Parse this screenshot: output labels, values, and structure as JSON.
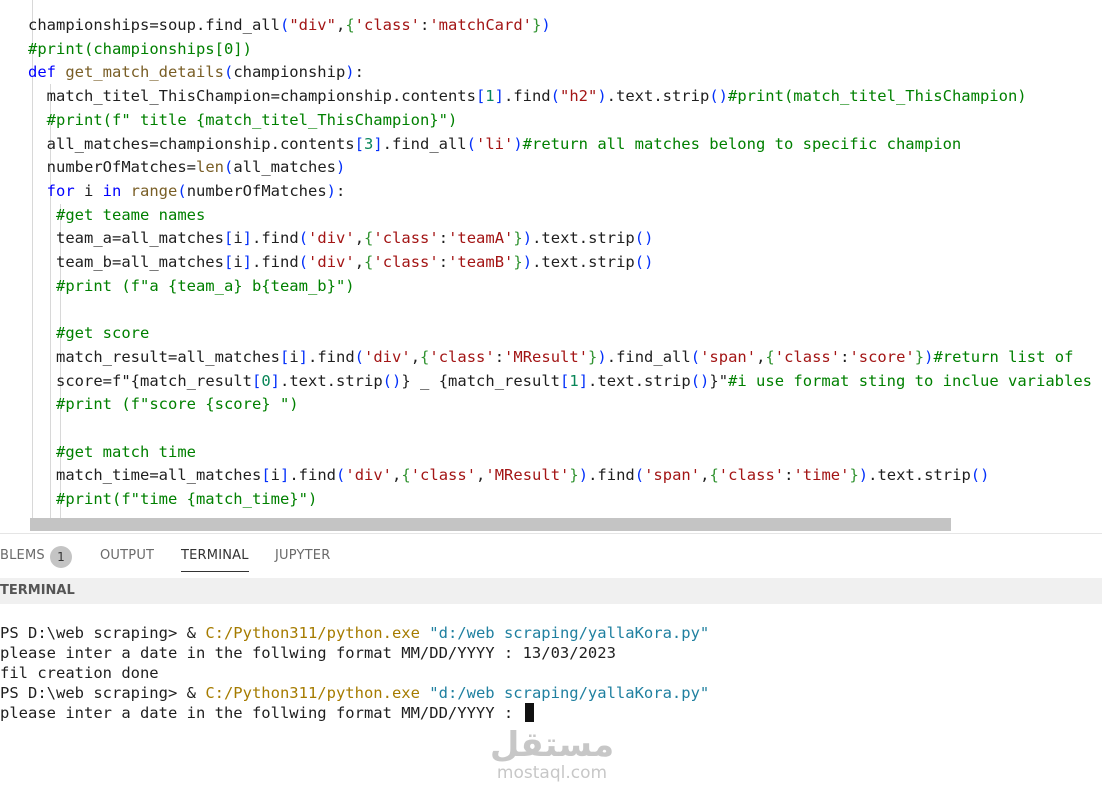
{
  "editor": {
    "lines": [
      {
        "indent": "   ",
        "tokens": [
          [
            "championships=soup.find_all",
            ""
          ],
          [
            "(",
            "p1"
          ],
          [
            "\"div\"",
            "str"
          ],
          [
            ",",
            ""
          ],
          [
            "{",
            "p2"
          ],
          [
            "'class'",
            "str"
          ],
          [
            ":",
            ""
          ],
          [
            "'matchCard'",
            "str"
          ],
          [
            "}",
            "p2"
          ],
          [
            ")",
            "p1"
          ]
        ]
      },
      {
        "indent": "   ",
        "tokens": [
          [
            "#print(championships[0])",
            "com"
          ]
        ]
      },
      {
        "indent": "   ",
        "tokens": [
          [
            "def ",
            "kw"
          ],
          [
            "get_match_details",
            "fn"
          ],
          [
            "(",
            "p1"
          ],
          [
            "championship",
            ""
          ],
          [
            ")",
            "p1"
          ],
          [
            ":",
            ""
          ]
        ]
      },
      {
        "indent": "     ",
        "tokens": [
          [
            "match_titel_ThisChampion=championship.contents",
            ""
          ],
          [
            "[",
            "p1"
          ],
          [
            "1",
            "num"
          ],
          [
            "]",
            "p1"
          ],
          [
            ".find",
            ""
          ],
          [
            "(",
            "p1"
          ],
          [
            "\"h2\"",
            "str"
          ],
          [
            ")",
            "p1"
          ],
          [
            ".text.strip",
            ""
          ],
          [
            "()",
            "p1"
          ],
          [
            "#print(match_titel_ThisChampion)",
            "com"
          ]
        ]
      },
      {
        "indent": "     ",
        "tokens": [
          [
            "#print(f\" title {match_titel_ThisChampion}\")",
            "com"
          ]
        ]
      },
      {
        "indent": "     ",
        "tokens": [
          [
            "all_matches=championship.contents",
            ""
          ],
          [
            "[",
            "p1"
          ],
          [
            "3",
            "num"
          ],
          [
            "]",
            "p1"
          ],
          [
            ".find_all",
            ""
          ],
          [
            "(",
            "p1"
          ],
          [
            "'li'",
            "str"
          ],
          [
            ")",
            "p1"
          ],
          [
            "#return all matches belong to specific champion",
            "com"
          ]
        ]
      },
      {
        "indent": "     ",
        "tokens": [
          [
            "numberOfMatches=",
            ""
          ],
          [
            "len",
            "fn"
          ],
          [
            "(",
            "p1"
          ],
          [
            "all_matches",
            ""
          ],
          [
            ")",
            "p1"
          ]
        ]
      },
      {
        "indent": "     ",
        "tokens": [
          [
            "for ",
            "kw"
          ],
          [
            "i ",
            ""
          ],
          [
            "in ",
            "kw"
          ],
          [
            "range",
            "fn"
          ],
          [
            "(",
            "p1"
          ],
          [
            "numberOfMatches",
            ""
          ],
          [
            ")",
            "p1"
          ],
          [
            ":",
            ""
          ]
        ]
      },
      {
        "indent": "      ",
        "tokens": [
          [
            "#get teame names",
            "com"
          ]
        ]
      },
      {
        "indent": "      ",
        "tokens": [
          [
            "team_a=all_matches",
            ""
          ],
          [
            "[",
            "p1"
          ],
          [
            "i",
            ""
          ],
          [
            "]",
            "p1"
          ],
          [
            ".find",
            ""
          ],
          [
            "(",
            "p1"
          ],
          [
            "'div'",
            "str"
          ],
          [
            ",",
            ""
          ],
          [
            "{",
            "p2"
          ],
          [
            "'class'",
            "str"
          ],
          [
            ":",
            ""
          ],
          [
            "'teamA'",
            "str"
          ],
          [
            "}",
            "p2"
          ],
          [
            ")",
            "p1"
          ],
          [
            ".text.strip",
            ""
          ],
          [
            "()",
            "p1"
          ]
        ]
      },
      {
        "indent": "      ",
        "tokens": [
          [
            "team_b=all_matches",
            ""
          ],
          [
            "[",
            "p1"
          ],
          [
            "i",
            ""
          ],
          [
            "]",
            "p1"
          ],
          [
            ".find",
            ""
          ],
          [
            "(",
            "p1"
          ],
          [
            "'div'",
            "str"
          ],
          [
            ",",
            ""
          ],
          [
            "{",
            "p2"
          ],
          [
            "'class'",
            "str"
          ],
          [
            ":",
            ""
          ],
          [
            "'teamB'",
            "str"
          ],
          [
            "}",
            "p2"
          ],
          [
            ")",
            "p1"
          ],
          [
            ".text.strip",
            ""
          ],
          [
            "()",
            "p1"
          ]
        ]
      },
      {
        "indent": "      ",
        "tokens": [
          [
            "#print (f\"a {team_a} b{team_b}\")",
            "com"
          ]
        ]
      },
      {
        "indent": "",
        "tokens": []
      },
      {
        "indent": "      ",
        "tokens": [
          [
            "#get score",
            "com"
          ]
        ]
      },
      {
        "indent": "      ",
        "tokens": [
          [
            "match_result=all_matches",
            ""
          ],
          [
            "[",
            "p1"
          ],
          [
            "i",
            ""
          ],
          [
            "]",
            "p1"
          ],
          [
            ".find",
            ""
          ],
          [
            "(",
            "p1"
          ],
          [
            "'div'",
            "str"
          ],
          [
            ",",
            ""
          ],
          [
            "{",
            "p2"
          ],
          [
            "'class'",
            "str"
          ],
          [
            ":",
            ""
          ],
          [
            "'MResult'",
            "str"
          ],
          [
            "}",
            "p2"
          ],
          [
            ")",
            "p1"
          ],
          [
            ".find_all",
            ""
          ],
          [
            "(",
            "p1"
          ],
          [
            "'span'",
            "str"
          ],
          [
            ",",
            ""
          ],
          [
            "{",
            "p2"
          ],
          [
            "'class'",
            "str"
          ],
          [
            ":",
            ""
          ],
          [
            "'score'",
            "str"
          ],
          [
            "}",
            "p2"
          ],
          [
            ")",
            "p1"
          ],
          [
            "#return list of",
            "com"
          ]
        ]
      },
      {
        "indent": "      ",
        "tokens": [
          [
            "score=f\"",
            ""
          ],
          [
            "{",
            ""
          ],
          [
            "match_result",
            ""
          ],
          [
            "[",
            "p1"
          ],
          [
            "0",
            "num"
          ],
          [
            "]",
            "p1"
          ],
          [
            ".text.strip",
            ""
          ],
          [
            "()",
            "p1"
          ],
          [
            "}",
            ""
          ],
          [
            " _ ",
            ""
          ],
          [
            "{",
            ""
          ],
          [
            "match_result",
            ""
          ],
          [
            "[",
            "p1"
          ],
          [
            "1",
            "num"
          ],
          [
            "]",
            "p1"
          ],
          [
            ".text.strip",
            ""
          ],
          [
            "()",
            "p1"
          ],
          [
            "}\"",
            ""
          ],
          [
            "#i use format sting to inclue variables",
            "com"
          ]
        ]
      },
      {
        "indent": "      ",
        "tokens": [
          [
            "#print (f\"score {score} \")",
            "com"
          ]
        ]
      },
      {
        "indent": "",
        "tokens": []
      },
      {
        "indent": "      ",
        "tokens": [
          [
            "#get match time",
            "com"
          ]
        ]
      },
      {
        "indent": "      ",
        "tokens": [
          [
            "match_time=all_matches",
            ""
          ],
          [
            "[",
            "p1"
          ],
          [
            "i",
            ""
          ],
          [
            "]",
            "p1"
          ],
          [
            ".find",
            ""
          ],
          [
            "(",
            "p1"
          ],
          [
            "'div'",
            "str"
          ],
          [
            ",",
            ""
          ],
          [
            "{",
            "p2"
          ],
          [
            "'class'",
            "str"
          ],
          [
            ",",
            ""
          ],
          [
            "'MResult'",
            "str"
          ],
          [
            "}",
            "p2"
          ],
          [
            ")",
            "p1"
          ],
          [
            ".find",
            ""
          ],
          [
            "(",
            "p1"
          ],
          [
            "'span'",
            "str"
          ],
          [
            ",",
            ""
          ],
          [
            "{",
            "p2"
          ],
          [
            "'class'",
            "str"
          ],
          [
            ":",
            ""
          ],
          [
            "'time'",
            "str"
          ],
          [
            "}",
            "p2"
          ],
          [
            ")",
            "p1"
          ],
          [
            ".text.strip",
            ""
          ],
          [
            "()",
            "p1"
          ]
        ]
      },
      {
        "indent": "      ",
        "tokens": [
          [
            "#print(f\"time {match_time}\")",
            "com"
          ]
        ]
      }
    ]
  },
  "panel": {
    "tabs": [
      {
        "id": "problems",
        "label": "BLEMS",
        "badge": "1"
      },
      {
        "id": "output",
        "label": "OUTPUT"
      },
      {
        "id": "terminal",
        "label": "TERMINAL",
        "active": true
      },
      {
        "id": "jupyter",
        "label": "JUPYTER"
      }
    ],
    "section_title": "TERMINAL"
  },
  "terminal": {
    "lines": [
      {
        "segments": [
          [
            "PS D:\\web scraping> & ",
            ""
          ],
          [
            "C:/Python311/python.exe",
            "yellow"
          ],
          [
            " ",
            ""
          ],
          [
            "\"d:/web scraping/yallaKora.py\"",
            "cyan"
          ]
        ]
      },
      {
        "segments": [
          [
            "please inter a date in the follwing format MM/DD/YYYY : 13/03/2023",
            ""
          ]
        ]
      },
      {
        "segments": [
          [
            "fil creation done",
            ""
          ]
        ]
      },
      {
        "segments": [
          [
            "PS D:\\web scraping> & ",
            ""
          ],
          [
            "C:/Python311/python.exe",
            "yellow"
          ],
          [
            " ",
            ""
          ],
          [
            "\"d:/web scraping/yallaKora.py\"",
            "cyan"
          ]
        ]
      },
      {
        "segments": [
          [
            "please inter a date in the follwing format MM/DD/YYYY : ",
            ""
          ]
        ],
        "cursor": true
      }
    ]
  },
  "watermark": {
    "arabic": "مستقل",
    "latin": "mostaql.com"
  },
  "colors": {
    "string": "#a31515",
    "keyword": "#0000ff",
    "function": "#795e26",
    "number": "#098658",
    "comment": "#008000",
    "terminal_path": "#a57b00",
    "terminal_string": "#2080a0"
  }
}
